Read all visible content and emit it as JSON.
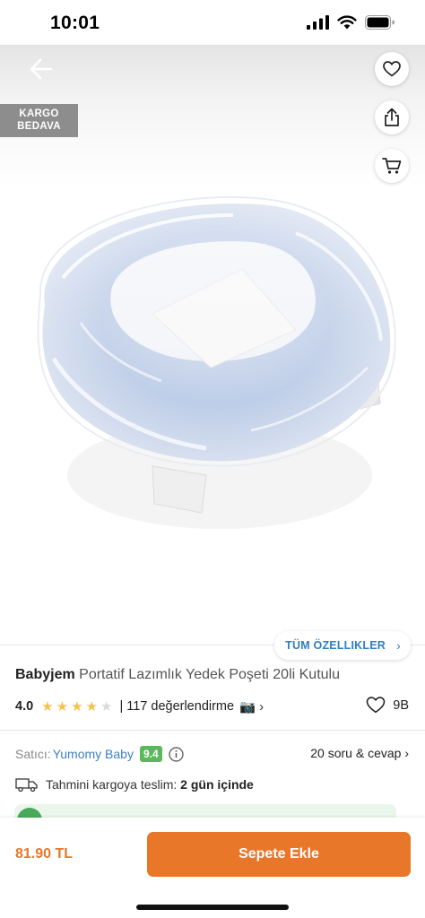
{
  "status_bar": {
    "time": "10:01"
  },
  "badge": {
    "line1": "KARGO",
    "line2": "BEDAVA"
  },
  "features": {
    "label": "TÜM ÖZELLIKLER",
    "chevron": "›"
  },
  "product": {
    "brand": "Babyjem",
    "name": "Portatif Lazımlık Yedek Poşeti 20li Kutulu"
  },
  "rating": {
    "value": "4.0",
    "stars_filled": 4,
    "stars_total": 5,
    "review_text": "| 117 değerlendirme",
    "camera_icon": "📷",
    "chevron": "›"
  },
  "likes": {
    "count": "9B"
  },
  "seller": {
    "prefix": "Satıcı:",
    "name": "Yumomy Baby",
    "score": "9.4"
  },
  "qa": {
    "label": "20 soru & cevap",
    "chevron": "›"
  },
  "delivery": {
    "label": "Tahmini kargoya teslim:",
    "value": "2 gün içinde"
  },
  "bottom": {
    "price": "81.90 TL",
    "button_label": "Sepete Ekle"
  },
  "colors": {
    "accent": "#e8772a",
    "link": "#3d7fc2",
    "score": "#5cb85c",
    "star": "#f6c24a"
  },
  "icons": [
    "back-arrow-icon",
    "heart-icon",
    "share-icon",
    "cart-icon",
    "star-icon",
    "camera-icon",
    "info-icon",
    "truck-icon"
  ]
}
